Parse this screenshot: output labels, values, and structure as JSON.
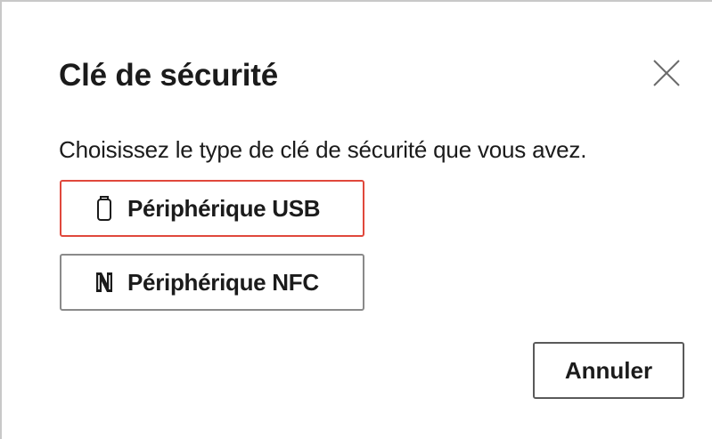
{
  "dialog": {
    "title": "Clé de sécurité",
    "close_icon": "close-icon",
    "prompt": "Choisissez le type de clé de sécurité que vous avez.",
    "options": [
      {
        "label": "Périphérique USB",
        "icon": "usb-key-icon",
        "selected": true
      },
      {
        "label": "Périphérique NFC",
        "icon": "nfc-icon",
        "selected": false
      }
    ],
    "cancel_label": "Annuler"
  },
  "colors": {
    "selection_border": "#e0483c",
    "text": "#1b1b1b"
  }
}
